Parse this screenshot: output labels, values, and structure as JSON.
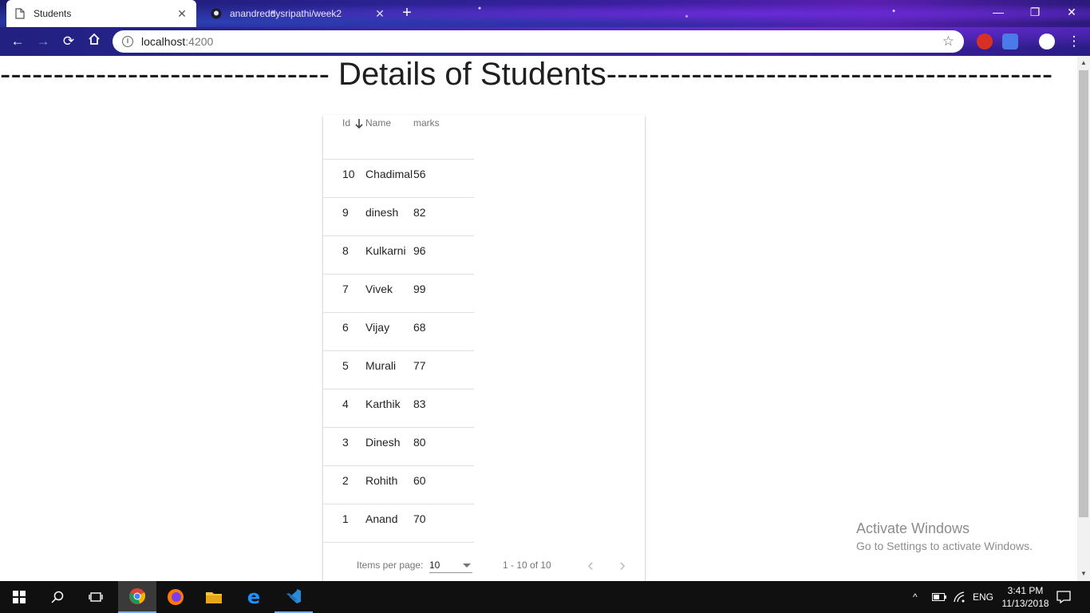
{
  "browser": {
    "tabs": [
      {
        "title": "Students",
        "active": true
      },
      {
        "title": "anandreddysripathi/week2",
        "active": false
      }
    ],
    "url_host": "localhost",
    "url_port": ":4200"
  },
  "page": {
    "heading_left": "-------------------------------",
    "heading_title": " Details of Students",
    "heading_right": "------------------------------------------"
  },
  "table": {
    "columns": {
      "id": "Id",
      "name": "Name",
      "marks": "marks"
    },
    "sort": {
      "column": "Name",
      "direction": "desc"
    },
    "rows": [
      {
        "id": "10",
        "name": "Chadimal",
        "marks": "56"
      },
      {
        "id": "9",
        "name": "dinesh",
        "marks": "82"
      },
      {
        "id": "8",
        "name": "Kulkarni",
        "marks": "96"
      },
      {
        "id": "7",
        "name": "Vivek",
        "marks": "99"
      },
      {
        "id": "6",
        "name": "Vijay",
        "marks": "68"
      },
      {
        "id": "5",
        "name": "Murali",
        "marks": "77"
      },
      {
        "id": "4",
        "name": "Karthik",
        "marks": "83"
      },
      {
        "id": "3",
        "name": "Dinesh",
        "marks": "80"
      },
      {
        "id": "2",
        "name": "Rohith",
        "marks": "60"
      },
      {
        "id": "1",
        "name": "Anand",
        "marks": "70"
      }
    ]
  },
  "paginator": {
    "items_per_page_label": "Items per page:",
    "items_per_page_value": "10",
    "range_label": "1 - 10 of 10"
  },
  "watermark": {
    "line1": "Activate Windows",
    "line2": "Go to Settings to activate Windows."
  },
  "taskbar": {
    "language": "ENG",
    "time": "3:41 PM",
    "date": "11/13/2018"
  },
  "colors": {
    "accent_blue": "#3f51b5",
    "table_border": "#e0e0e0",
    "header_text": "#757575"
  }
}
